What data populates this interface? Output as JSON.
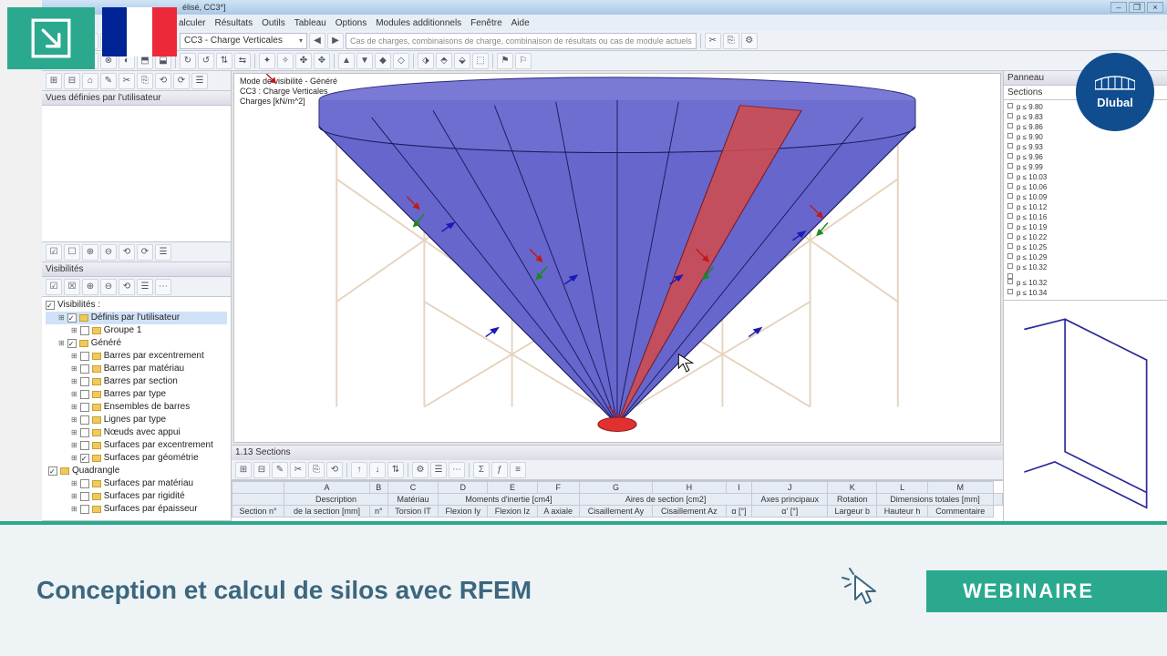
{
  "overlay": {
    "flag_country": "France",
    "brand": "Dlubal",
    "title_line": "Conception et calcul de silos avec RFEM",
    "badge": "WEBINAIRE"
  },
  "app": {
    "title_suffix": "élisé, CC3*]",
    "menus": [
      "alculer",
      "Résultats",
      "Outils",
      "Tableau",
      "Options",
      "Modules additionnels",
      "Fenêtre",
      "Aide"
    ],
    "combo_loadcase": "CC3 - Charge Verticales",
    "search_placeholder": "Cas de charges, combinaisons de charge, combinaison de résultats ou cas de module actuels"
  },
  "left": {
    "views_header": "Vues définies par l'utilisateur",
    "visib_header": "Visibilités",
    "visib_check": "Visibilités :",
    "tree": [
      {
        "lvl": 1,
        "chk": true,
        "label": "Définis par l'utilisateur",
        "sel": true
      },
      {
        "lvl": 2,
        "chk": false,
        "label": "Groupe 1"
      },
      {
        "lvl": 1,
        "chk": true,
        "label": "Généré"
      },
      {
        "lvl": 2,
        "chk": false,
        "label": "Barres par excentrement"
      },
      {
        "lvl": 2,
        "chk": false,
        "label": "Barres par matériau"
      },
      {
        "lvl": 2,
        "chk": false,
        "label": "Barres par section"
      },
      {
        "lvl": 2,
        "chk": false,
        "label": "Barres par type"
      },
      {
        "lvl": 2,
        "chk": false,
        "label": "Ensembles de barres"
      },
      {
        "lvl": 2,
        "chk": false,
        "label": "Lignes par type"
      },
      {
        "lvl": 2,
        "chk": false,
        "label": "Nœuds avec appui"
      },
      {
        "lvl": 2,
        "chk": false,
        "label": "Surfaces par excentrement"
      },
      {
        "lvl": 2,
        "chk": true,
        "label": "Surfaces par géométrie"
      },
      {
        "lvl": 3,
        "chk": true,
        "label": "Quadrangle"
      },
      {
        "lvl": 2,
        "chk": false,
        "label": "Surfaces par matériau"
      },
      {
        "lvl": 2,
        "chk": false,
        "label": "Surfaces par rigidité"
      },
      {
        "lvl": 2,
        "chk": false,
        "label": "Surfaces par épaisseur"
      }
    ]
  },
  "viewport": {
    "line1": "Mode de visibilité - Généré",
    "line2": "CC3 : Charge Verticales",
    "line3": "Charges [kN/m^2]"
  },
  "right": {
    "header": "Panneau",
    "tab": "Sections",
    "values": [
      "p ≤ 9.80",
      "p ≤ 9.83",
      "p ≤ 9.86",
      "p ≤ 9.90",
      "p ≤ 9.93",
      "p ≤ 9.96",
      "p ≤ 9.99",
      "p ≤ 10.03",
      "p ≤ 10.06",
      "p ≤ 10.09",
      "p ≤ 10.12",
      "p ≤ 10.16",
      "p ≤ 10.19",
      "p ≤ 10.22",
      "p ≤ 10.25",
      "p ≤ 10.29",
      "p ≤ 10.32",
      "",
      "p ≤ 10.32",
      "p ≤ 10.34"
    ]
  },
  "table": {
    "tab": "1.13 Sections",
    "letters": [
      "A",
      "B",
      "C",
      "D",
      "E",
      "F",
      "G",
      "H",
      "I",
      "J",
      "K",
      "L",
      "M"
    ],
    "group_headers": [
      "Description",
      "Matériau",
      "Moments d'inertie [cm4]",
      "Aires de section [cm2]",
      "Axes principaux",
      "Rotation",
      "Dimensions totales [mm]",
      ""
    ],
    "sub_headers": [
      "Section n°",
      "de la section [mm]",
      "n°",
      "Torsion IT",
      "Flexion Iy",
      "Flexion Iz",
      "A axiale",
      "Cisaillement Ay",
      "Cisaillement Az",
      "α [°]",
      "α' [°]",
      "Largeur b",
      "Hauteur h",
      "Commentaire"
    ]
  }
}
